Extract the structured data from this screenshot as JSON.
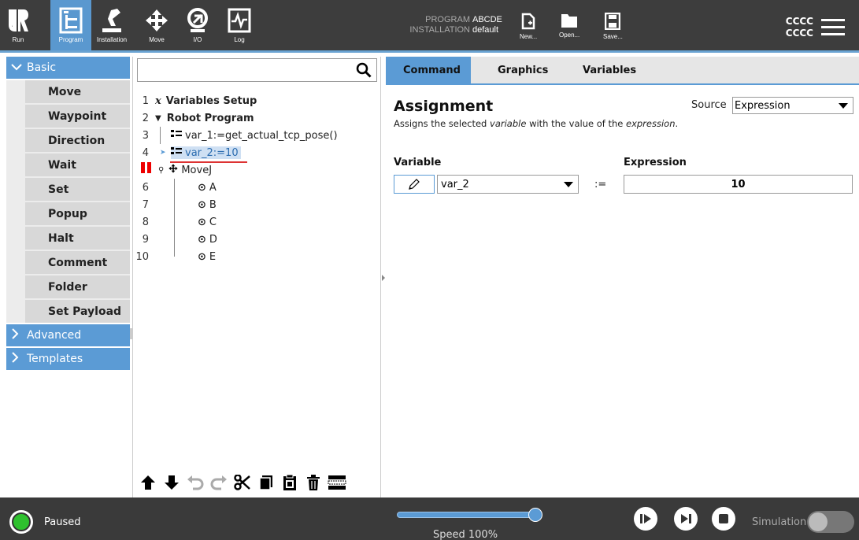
{
  "topbar": {
    "nav": [
      {
        "label": "Run",
        "icon": "ur-logo-icon"
      },
      {
        "label": "Program",
        "icon": "program-tree-icon"
      },
      {
        "label": "Installation",
        "icon": "robot-arm-icon"
      },
      {
        "label": "Move",
        "icon": "move-arrows-icon"
      },
      {
        "label": "I/O",
        "icon": "io-icon"
      },
      {
        "label": "Log",
        "icon": "log-icon"
      }
    ],
    "program_label": "PROGRAM",
    "program_value": "ABCDE",
    "installation_label": "INSTALLATION",
    "installation_value": "default",
    "new_label": "New...",
    "open_label": "Open...",
    "save_label": "Save...",
    "user_line1": "CCCC",
    "user_line2": "CCCC"
  },
  "sidebar": {
    "basic_label": "Basic",
    "items": [
      "Move",
      "Waypoint",
      "Direction",
      "Wait",
      "Set",
      "Popup",
      "Halt",
      "Comment",
      "Folder",
      "Set Payload"
    ],
    "advanced_label": "Advanced",
    "templates_label": "Templates"
  },
  "tree": {
    "lines": [
      {
        "num": "1",
        "text": "Variables Setup"
      },
      {
        "num": "2",
        "text": "Robot Program"
      },
      {
        "num": "3",
        "text": "var_1:=get_actual_tcp_pose()"
      },
      {
        "num": "4",
        "text": "var_2:=10"
      },
      {
        "num": "",
        "text": "MoveJ"
      },
      {
        "num": "6",
        "text": "A"
      },
      {
        "num": "7",
        "text": "B"
      },
      {
        "num": "8",
        "text": "C"
      },
      {
        "num": "9",
        "text": "D"
      },
      {
        "num": "10",
        "text": "E"
      }
    ]
  },
  "tabs": [
    "Command",
    "Graphics",
    "Variables"
  ],
  "command": {
    "title": "Assignment",
    "desc_a": "Assigns the selected ",
    "desc_b": "variable",
    "desc_c": " with the value of the ",
    "desc_d": "expression",
    "desc_e": ".",
    "source_label": "Source",
    "source_value": "Expression",
    "variable_label": "Variable",
    "expression_label": "Expression",
    "variable_value": "var_2",
    "assign_op": ":=",
    "expression_value": "10"
  },
  "bottombar": {
    "status": "Paused",
    "speed": "Speed 100%",
    "speed_fraction": 1.0,
    "simulation": "Simulation"
  },
  "colors": {
    "accent": "#5b9bd5",
    "topbar_bg": "#3d3d3d",
    "status_green": "#2ec12e"
  }
}
